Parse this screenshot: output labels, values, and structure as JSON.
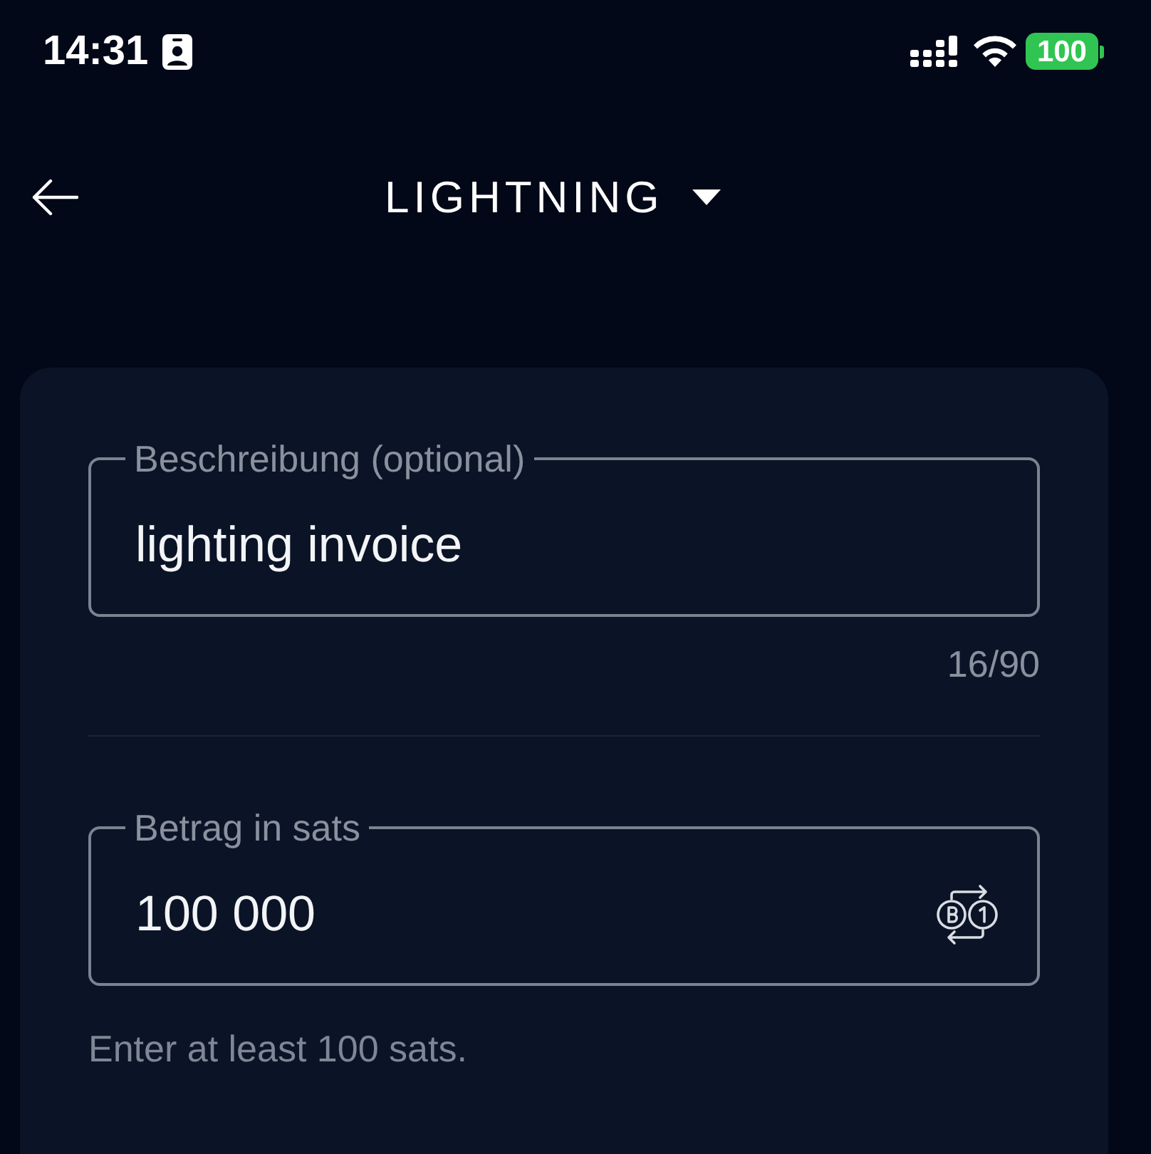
{
  "status_bar": {
    "time": "14:31",
    "battery": "100"
  },
  "header": {
    "title": "LIGHTNING"
  },
  "form": {
    "fields": [
      {
        "kind": "text",
        "label": "Beschreibung (optional)",
        "value": "lighting invoice",
        "counter": "16/90"
      },
      {
        "kind": "amount",
        "label": "Betrag in sats",
        "value": "100 000",
        "helper": "Enter at least 100 sats."
      }
    ]
  }
}
